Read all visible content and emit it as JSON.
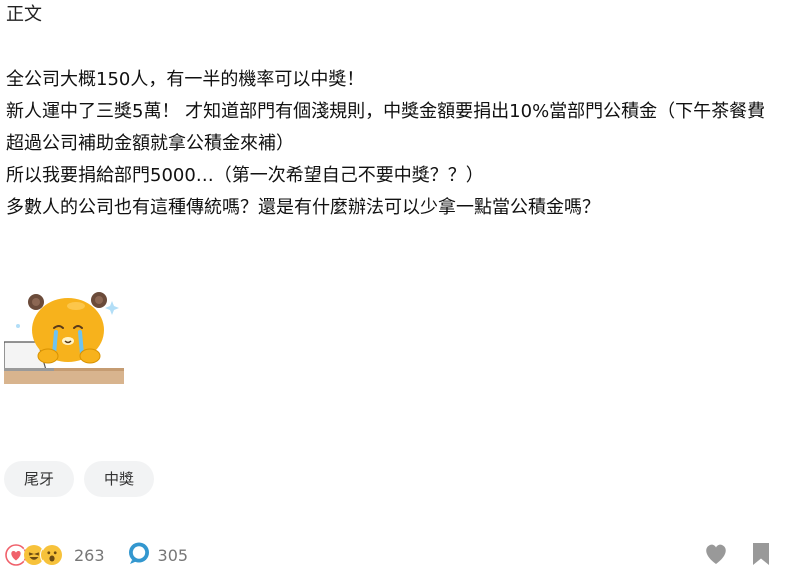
{
  "post": {
    "section_label": "正文",
    "lines": [
      "全公司大概150人，有一半的機率可以中獎！",
      "新人運中了三獎5萬！ 才知道部門有個淺規則，中獎金額要捐出10%當部門公積金（下午茶餐費",
      "超過公司補助金額就拿公積金來補）",
      "所以我要捐給部門5000…（第一次希望自己不要中獎？？）",
      "多數人的公司也有這種傳統嗎？還是有什麼辦法可以少拿一點當公積金嗎？"
    ]
  },
  "sticker": {
    "icon": "crying-bear-at-laptop-sticker"
  },
  "tags": [
    "尾牙",
    "中獎"
  ],
  "footer": {
    "reaction_icons": [
      "heart-reaction-icon",
      "laugh-reaction-icon",
      "wow-reaction-icon"
    ],
    "reaction_count": "263",
    "comment_count": "305",
    "colors": {
      "heart": "#f0616b",
      "emoji": "#f7c23b",
      "comment": "#3397cf",
      "muted": "#777777"
    }
  }
}
